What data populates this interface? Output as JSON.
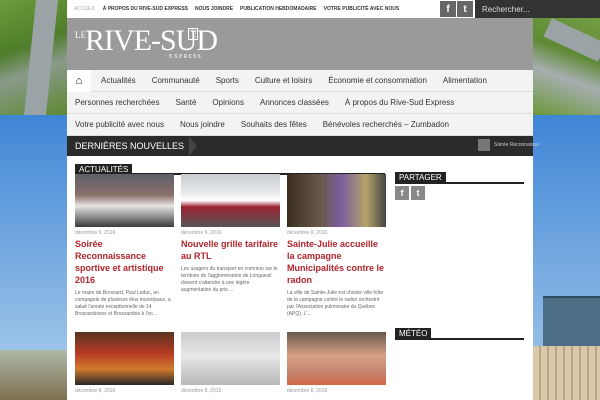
{
  "topbar": {
    "links": [
      "ACCUEIL",
      "À PROPOS DU RIVE-SUD EXPRESS",
      "NOUS JOINDRE",
      "PUBLICATION HEBDOMADAIRE",
      "VOTRE PUBLICITÉ AVEC NOUS"
    ],
    "social_facebook": "f",
    "social_twitter": "t",
    "search_placeholder": "Rechercher..."
  },
  "logo": {
    "le": "LE",
    "name": "RIVE-SUD",
    "ca": ".CA",
    "express": "EXPRESS"
  },
  "nav": {
    "row1": [
      "Actualités",
      "Communauté",
      "Sports",
      "Culture et loisirs",
      "Économie et consommation",
      "Alimentation"
    ],
    "row2": [
      "Personnes recherchées",
      "Santé",
      "Opinions",
      "Annonces classées",
      "À propos du Rive-Sud Express"
    ],
    "row3": [
      "Votre publicité avec nous",
      "Nous joindre",
      "Souhaits des fêtes",
      "Bénévoles recherchés – Zumbadon"
    ]
  },
  "ticker": {
    "label": "DERNIÈRES NOUVELLES",
    "headline": "Soirée Reconnaissa"
  },
  "sections": {
    "actualites": "ACTUALITÉS",
    "partager": "PARTAGER",
    "meteo": "MÉTÉO"
  },
  "articles": [
    {
      "date": "décembre 9, 2016",
      "title": "Soirée Reconnaissance sportive et artistique 2016",
      "excerpt": "Le maire de Brossard, Paul Leduc, en compagnie de plusieurs élus municipaux, a salué l'année exceptionnelle de 14 Brossardoises et Brossardois à l'oc..."
    },
    {
      "date": "décembre 9, 2016",
      "title": "Nouvelle grille tarifaire au RTL",
      "excerpt": "Les usagers du transport en commun sur le territoire de l'agglomération de Longueuil doivent s'attendre à une légère augmentation du prix ..."
    },
    {
      "date": "décembre 9, 2016",
      "title": "Sainte-Julie accueille la campagne Municipalités contre le radon",
      "excerpt": "La ville de Sainte-Julie est choisie ville hôte de la campagne contre le radon orchestré par l'Association pulmonaire du Québec (APQ). L'..."
    },
    {
      "date": "décembre 8, 2016"
    },
    {
      "date": "décembre 8, 2016"
    },
    {
      "date": "décembre 8, 2016"
    }
  ]
}
